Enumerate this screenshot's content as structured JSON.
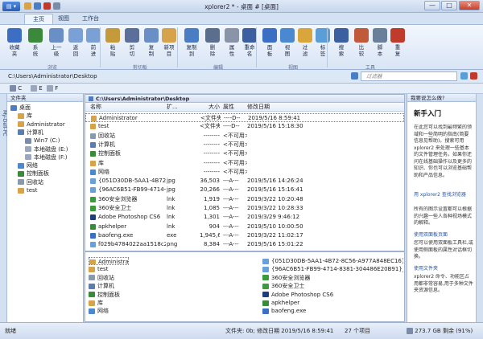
{
  "window": {
    "title": "xplorer2 * - 桌面 # [桌面]",
    "app_menu_label": "▤ ▾",
    "min": "—",
    "max": "□",
    "close": "✕"
  },
  "ribbon_tabs": [
    {
      "label": "主页",
      "active": true
    },
    {
      "label": "视图",
      "active": false
    },
    {
      "label": "工作台",
      "active": false
    }
  ],
  "ribbon_buttons": [
    {
      "label": "收藏\n夹",
      "color": "#3c6fc4",
      "icon": "star-icon"
    },
    {
      "label": "系\n统",
      "color": "#3b8a3b",
      "icon": "computer-icon"
    },
    {
      "label": "上一\n级",
      "color": "#6a8fc6",
      "icon": "up-arrow-icon"
    },
    {
      "label": "返\n回",
      "color": "#7aa0d6",
      "icon": "back-arrow-icon"
    },
    {
      "label": "前\n进",
      "color": "#7aa0d6",
      "icon": "forward-arrow-icon"
    },
    {
      "label": "粘\n贴",
      "color": "#c59a3b",
      "icon": "paste-icon"
    },
    {
      "label": "剪\n切",
      "color": "#5a6f9a",
      "icon": "cut-icon"
    },
    {
      "label": "复\n制",
      "color": "#6a8fc6",
      "icon": "copy-icon"
    },
    {
      "label": "新项\n目",
      "color": "#d7a34a",
      "icon": "new-item-icon"
    },
    {
      "label": "复制\n到",
      "color": "#4a7dc4",
      "icon": "copy-to-icon"
    },
    {
      "label": "删\n除",
      "color": "#5b6e8e",
      "icon": "delete-icon"
    },
    {
      "label": "属\n性",
      "color": "#8a94a8",
      "icon": "properties-icon"
    },
    {
      "label": "重命\n名",
      "color": "#3b5fa0",
      "icon": "rename-icon"
    },
    {
      "label": "面\n板",
      "color": "#3b6fc4",
      "icon": "panel-icon"
    },
    {
      "label": "视\n图",
      "color": "#4a88d0",
      "icon": "view-icon"
    },
    {
      "label": "过\n滤",
      "color": "#d8a63a",
      "icon": "filter-icon"
    },
    {
      "label": "标\n签",
      "color": "#5a9ed8",
      "icon": "tag-icon"
    },
    {
      "label": "搜\n索",
      "color": "#3b5fa0",
      "icon": "search-icon"
    },
    {
      "label": "比\n较",
      "color": "#c05a3b",
      "icon": "compare-icon"
    },
    {
      "label": "脚\n本",
      "color": "#6a7f9a",
      "icon": "script-icon"
    },
    {
      "label": "重\n复",
      "color": "#c03b2b",
      "icon": "duplicate-icon"
    }
  ],
  "ribbon_groups": [
    "浏览",
    "剪切板",
    "编辑",
    "视图",
    "工具"
  ],
  "address": {
    "path": "C:\\Users\\Administrator\\Desktop",
    "search_placeholder": "过滤器"
  },
  "nav_row": {
    "drive_c": "C",
    "drive_e": "E",
    "drive_f": "F"
  },
  "tree": {
    "header": "文件夹",
    "side_label": "My-Dell-PC",
    "items": [
      {
        "label": "桌面",
        "indent": 0,
        "color": "#4a7dc4"
      },
      {
        "label": "库",
        "indent": 1,
        "color": "#d7a34a"
      },
      {
        "label": "Administrator",
        "indent": 1,
        "color": "#d7a34a"
      },
      {
        "label": "计算机",
        "indent": 1,
        "color": "#5b7db0"
      },
      {
        "label": "Win7 (C:)",
        "indent": 2,
        "color": "#7c8ca8"
      },
      {
        "label": "本地磁盘 (E:)",
        "indent": 2,
        "color": "#9aa7bd"
      },
      {
        "label": "本地磁盘 (F:)",
        "indent": 2,
        "color": "#9aa7bd"
      },
      {
        "label": "网络",
        "indent": 1,
        "color": "#4a88d0"
      },
      {
        "label": "控制面板",
        "indent": 1,
        "color": "#3b8a3b"
      },
      {
        "label": "回收站",
        "indent": 1,
        "color": "#8a9aae"
      },
      {
        "label": "test",
        "indent": 1,
        "color": "#d7a34a"
      }
    ]
  },
  "list": {
    "path_header": "C:\\Users\\Administrator\\Desktop",
    "columns": [
      "名称",
      "扩...",
      "大小",
      "属性",
      "修改日期"
    ],
    "rows": [
      {
        "name": "Administrator",
        "ext": "",
        "size": "<文件夹>",
        "attr": "----D--",
        "date": "2019/5/16 8:59:41",
        "color": "#d7a34a",
        "sel": true
      },
      {
        "name": "test",
        "ext": "",
        "size": "<文件夹>",
        "attr": "----D--",
        "date": "2019/5/16 15:18:30",
        "color": "#d7a34a",
        "sel": false
      },
      {
        "name": "回收站",
        "ext": "",
        "size": "--------",
        "attr": "<不可用>",
        "date": "",
        "color": "#8a9aae",
        "sel": false
      },
      {
        "name": "计算机",
        "ext": "",
        "size": "--------",
        "attr": "<不可用>",
        "date": "",
        "color": "#5b7db0",
        "sel": false
      },
      {
        "name": "控制面板",
        "ext": "",
        "size": "--------",
        "attr": "<不可用>",
        "date": "",
        "color": "#3b8a3b",
        "sel": false
      },
      {
        "name": "库",
        "ext": "",
        "size": "--------",
        "attr": "<不可用>",
        "date": "",
        "color": "#d7a34a",
        "sel": false
      },
      {
        "name": "网络",
        "ext": "",
        "size": "--------",
        "attr": "<不可用>",
        "date": "",
        "color": "#4a88d0",
        "sel": false
      },
      {
        "name": "{051D30DB-5AA1-4B72-...",
        "ext": "jpg",
        "size": "36,503",
        "attr": "---A---",
        "date": "2019/5/16 14:26:24",
        "color": "#6a9fd8",
        "sel": false
      },
      {
        "name": "{96AC6B51-FB99-4714-B...",
        "ext": "jpg",
        "size": "20,266",
        "attr": "---A---",
        "date": "2019/5/16 15:16:41",
        "color": "#6a9fd8",
        "sel": false
      },
      {
        "name": "360安全浏览器",
        "ext": "lnk",
        "size": "1,919",
        "attr": "---A---",
        "date": "2019/3/22 10:20:48",
        "color": "#3b9a3b",
        "sel": false
      },
      {
        "name": "360安全卫士",
        "ext": "lnk",
        "size": "1,085",
        "attr": "---A---",
        "date": "2019/3/22 10:28:33",
        "color": "#3b9a3b",
        "sel": false
      },
      {
        "name": "Adobe Photoshop CS6",
        "ext": "lnk",
        "size": "1,301",
        "attr": "---A---",
        "date": "2019/3/29 9:46:12",
        "color": "#1f3f7a",
        "sel": false
      },
      {
        "name": "apkhelper",
        "ext": "lnk",
        "size": "904",
        "attr": "---A---",
        "date": "2019/5/10 10:00:50",
        "color": "#3b8a3b",
        "sel": false
      },
      {
        "name": "baofeng.exe",
        "ext": "exe",
        "size": "1,945,600",
        "attr": "---A---",
        "date": "2019/3/22 11:02:17",
        "color": "#3b6fc4",
        "sel": false
      },
      {
        "name": "f029b4784022aa1518c2f...",
        "ext": "png",
        "size": "8,384",
        "attr": "---A---",
        "date": "2019/5/16 15:01:22",
        "color": "#6a9fd8",
        "sel": false
      }
    ]
  },
  "bottom": {
    "left": [
      {
        "name": "Administrator",
        "color": "#d7a34a"
      },
      {
        "name": "test",
        "color": "#d7a34a"
      },
      {
        "name": "回收站",
        "color": "#8a9aae"
      },
      {
        "name": "计算机",
        "color": "#5b7db0"
      },
      {
        "name": "控制面板",
        "color": "#3b8a3b"
      },
      {
        "name": "库",
        "color": "#d7a34a"
      },
      {
        "name": "网络",
        "color": "#4a88d0"
      }
    ],
    "right": [
      {
        "name": "{051D30DB-5AA1-4B72-8C56-A977A848EC16}_20190516",
        "color": "#6a9fd8"
      },
      {
        "name": "{96AC6B51-FB99-4714-8381-304486E20B91}_20190516",
        "color": "#6a9fd8"
      },
      {
        "name": "360安全浏览器",
        "color": "#3b9a3b"
      },
      {
        "name": "360安全卫士",
        "color": "#3b9a3b"
      },
      {
        "name": "Adobe Photoshop CS6",
        "color": "#1f3f7a"
      },
      {
        "name": "apkhelper",
        "color": "#3b8a3b"
      },
      {
        "name": "baofeng.exe",
        "color": "#3b6fc4"
      }
    ]
  },
  "preview": {
    "header": "我要说怎么做?",
    "title": "新手入门",
    "intro": "在此您可以找到最频繁的领域和一些简明的指南(简要信息见帮助)。搜索可用 xplorer2 来处理一些基本的文件管理任务。如果你还问在线基础操作以及更多的知识、你也可以浏览基础帮助和产品信息。",
    "link1": "用 xplorer2 查找浏览器",
    "text1": "所有的图示设置都可以根据的兴趣一些人各种视场模式的解释。",
    "link2": "使用双面板页面",
    "text2": "您可以使用双面板工具栏,或使用侧面板的属性对话框切换。",
    "link3": "使用文件夹",
    "text3": "xplorer2 命令、功能区占用都非常容易,用于多种文件夹资源信息。"
  },
  "status": {
    "left": "就绪",
    "middle": "文件夹: 0b; 修改日期 2019/5/16 8:59:41",
    "count": "27 个项目",
    "free": "273.7 GB 剩余 (91%)"
  }
}
